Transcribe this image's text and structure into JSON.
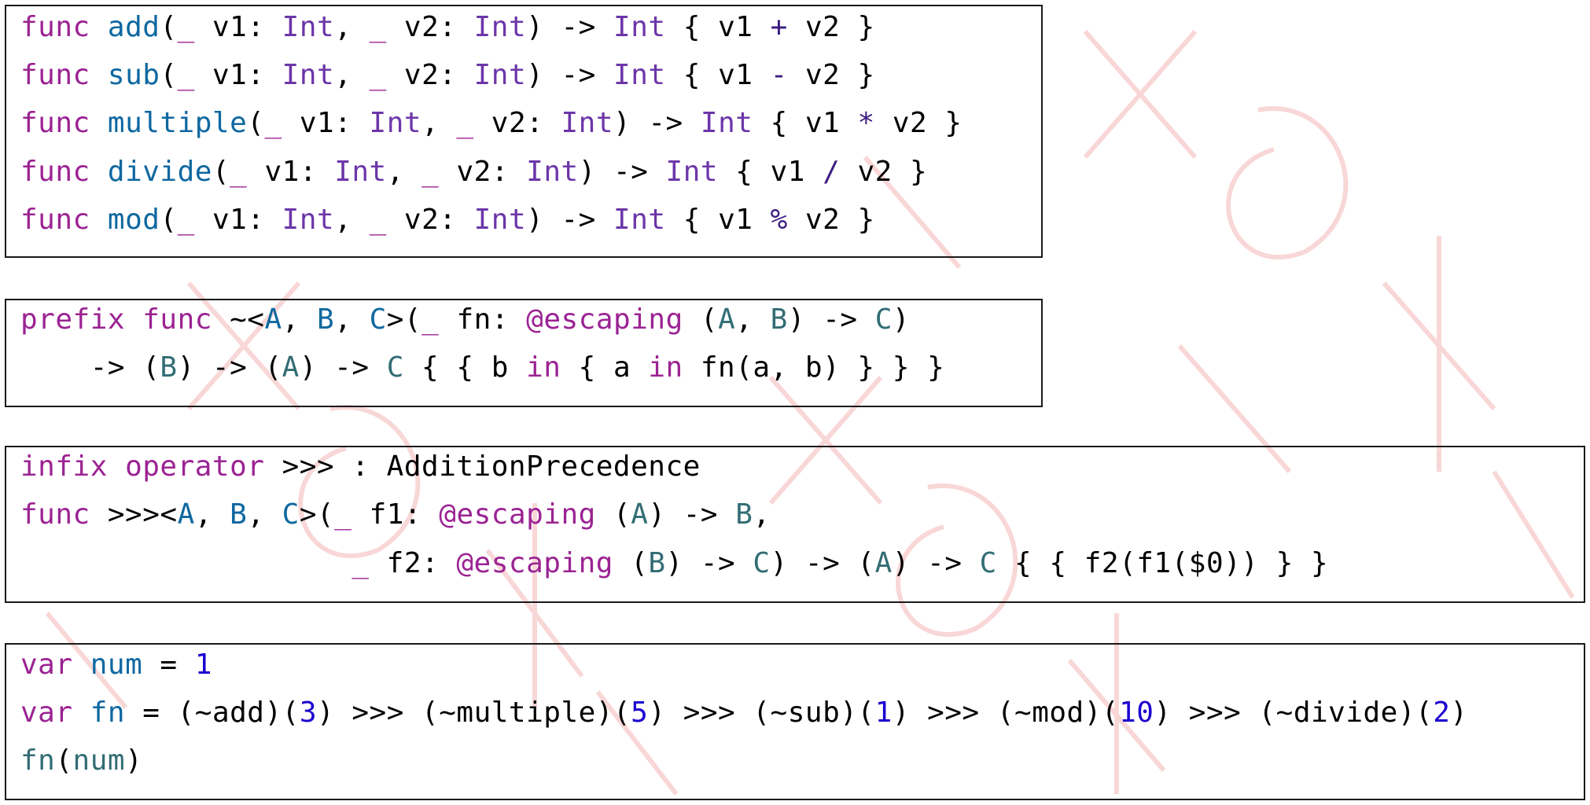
{
  "code_blocks": [
    {
      "lines": [
        [
          [
            "kw",
            "func"
          ],
          [
            "pl",
            " "
          ],
          [
            "fn",
            "add"
          ],
          [
            "pl",
            "("
          ],
          [
            "kw",
            "_"
          ],
          [
            "pl",
            " v1: "
          ],
          [
            "ty",
            "Int"
          ],
          [
            "pl",
            ", "
          ],
          [
            "kw",
            "_"
          ],
          [
            "pl",
            " v2: "
          ],
          [
            "ty",
            "Int"
          ],
          [
            "pl",
            ") -> "
          ],
          [
            "ty",
            "Int"
          ],
          [
            "pl",
            " { v1 "
          ],
          [
            "op",
            "+"
          ],
          [
            "pl",
            " v2 }"
          ]
        ],
        [
          [
            "kw",
            "func"
          ],
          [
            "pl",
            " "
          ],
          [
            "fn",
            "sub"
          ],
          [
            "pl",
            "("
          ],
          [
            "kw",
            "_"
          ],
          [
            "pl",
            " v1: "
          ],
          [
            "ty",
            "Int"
          ],
          [
            "pl",
            ", "
          ],
          [
            "kw",
            "_"
          ],
          [
            "pl",
            " v2: "
          ],
          [
            "ty",
            "Int"
          ],
          [
            "pl",
            ") -> "
          ],
          [
            "ty",
            "Int"
          ],
          [
            "pl",
            " { v1 "
          ],
          [
            "op",
            "-"
          ],
          [
            "pl",
            " v2 }"
          ]
        ],
        [
          [
            "kw",
            "func"
          ],
          [
            "pl",
            " "
          ],
          [
            "fn",
            "multiple"
          ],
          [
            "pl",
            "("
          ],
          [
            "kw",
            "_"
          ],
          [
            "pl",
            " v1: "
          ],
          [
            "ty",
            "Int"
          ],
          [
            "pl",
            ", "
          ],
          [
            "kw",
            "_"
          ],
          [
            "pl",
            " v2: "
          ],
          [
            "ty",
            "Int"
          ],
          [
            "pl",
            ") -> "
          ],
          [
            "ty",
            "Int"
          ],
          [
            "pl",
            " { v1 "
          ],
          [
            "op",
            "*"
          ],
          [
            "pl",
            " v2 }"
          ]
        ],
        [
          [
            "kw",
            "func"
          ],
          [
            "pl",
            " "
          ],
          [
            "fn",
            "divide"
          ],
          [
            "pl",
            "("
          ],
          [
            "kw",
            "_"
          ],
          [
            "pl",
            " v1: "
          ],
          [
            "ty",
            "Int"
          ],
          [
            "pl",
            ", "
          ],
          [
            "kw",
            "_"
          ],
          [
            "pl",
            " v2: "
          ],
          [
            "ty",
            "Int"
          ],
          [
            "pl",
            ") -> "
          ],
          [
            "ty",
            "Int"
          ],
          [
            "pl",
            " { v1 "
          ],
          [
            "op",
            "/"
          ],
          [
            "pl",
            " v2 }"
          ]
        ],
        [
          [
            "kw",
            "func"
          ],
          [
            "pl",
            " "
          ],
          [
            "fn",
            "mod"
          ],
          [
            "pl",
            "("
          ],
          [
            "kw",
            "_"
          ],
          [
            "pl",
            " v1: "
          ],
          [
            "ty",
            "Int"
          ],
          [
            "pl",
            ", "
          ],
          [
            "kw",
            "_"
          ],
          [
            "pl",
            " v2: "
          ],
          [
            "ty",
            "Int"
          ],
          [
            "pl",
            ") -> "
          ],
          [
            "ty",
            "Int"
          ],
          [
            "pl",
            " { v1 "
          ],
          [
            "op",
            "%"
          ],
          [
            "pl",
            " v2 }"
          ]
        ]
      ]
    },
    {
      "lines": [
        [
          [
            "kw",
            "prefix"
          ],
          [
            "pl",
            " "
          ],
          [
            "kw",
            "func"
          ],
          [
            "pl",
            " ~<"
          ],
          [
            "fn",
            "A"
          ],
          [
            "pl",
            ", "
          ],
          [
            "fn",
            "B"
          ],
          [
            "pl",
            ", "
          ],
          [
            "fn",
            "C"
          ],
          [
            "pl",
            ">("
          ],
          [
            "kw",
            "_"
          ],
          [
            "pl",
            " fn: "
          ],
          [
            "at",
            "@escaping"
          ],
          [
            "pl",
            " ("
          ],
          [
            "gn",
            "A"
          ],
          [
            "pl",
            ", "
          ],
          [
            "gn",
            "B"
          ],
          [
            "pl",
            ") -> "
          ],
          [
            "gn",
            "C"
          ],
          [
            "pl",
            ")"
          ]
        ],
        [
          [
            "pl",
            "    -> ("
          ],
          [
            "gn",
            "B"
          ],
          [
            "pl",
            ") -> ("
          ],
          [
            "gn",
            "A"
          ],
          [
            "pl",
            ") -> "
          ],
          [
            "gn",
            "C"
          ],
          [
            "pl",
            " { { b "
          ],
          [
            "kw",
            "in"
          ],
          [
            "pl",
            " { a "
          ],
          [
            "kw",
            "in"
          ],
          [
            "pl",
            " fn(a, b) } } }"
          ]
        ]
      ]
    },
    {
      "lines": [
        [
          [
            "kw",
            "infix"
          ],
          [
            "pl",
            " "
          ],
          [
            "kw",
            "operator"
          ],
          [
            "pl",
            " >>> : AdditionPrecedence"
          ]
        ],
        [
          [
            "kw",
            "func"
          ],
          [
            "pl",
            " >>><"
          ],
          [
            "fn",
            "A"
          ],
          [
            "pl",
            ", "
          ],
          [
            "fn",
            "B"
          ],
          [
            "pl",
            ", "
          ],
          [
            "fn",
            "C"
          ],
          [
            "pl",
            ">("
          ],
          [
            "kw",
            "_"
          ],
          [
            "pl",
            " f1: "
          ],
          [
            "at",
            "@escaping"
          ],
          [
            "pl",
            " ("
          ],
          [
            "gn",
            "A"
          ],
          [
            "pl",
            ") -> "
          ],
          [
            "gn",
            "B"
          ],
          [
            "pl",
            ","
          ]
        ],
        [
          [
            "pl",
            "                   "
          ],
          [
            "kw",
            "_"
          ],
          [
            "pl",
            " f2: "
          ],
          [
            "at",
            "@escaping"
          ],
          [
            "pl",
            " ("
          ],
          [
            "gn",
            "B"
          ],
          [
            "pl",
            ") -> "
          ],
          [
            "gn",
            "C"
          ],
          [
            "pl",
            ") -> ("
          ],
          [
            "gn",
            "A"
          ],
          [
            "pl",
            ") -> "
          ],
          [
            "gn",
            "C"
          ],
          [
            "pl",
            " { { f2(f1($0)) } }"
          ]
        ]
      ]
    },
    {
      "lines": [
        [
          [
            "kw",
            "var"
          ],
          [
            "pl",
            " "
          ],
          [
            "fn",
            "num"
          ],
          [
            "pl",
            " = "
          ],
          [
            "nm",
            "1"
          ]
        ],
        [
          [
            "kw",
            "var"
          ],
          [
            "pl",
            " "
          ],
          [
            "fn",
            "fn"
          ],
          [
            "pl",
            " = (~add)("
          ],
          [
            "nm",
            "3"
          ],
          [
            "pl",
            ") >>> (~multiple)("
          ],
          [
            "nm",
            "5"
          ],
          [
            "pl",
            ") >>> (~sub)("
          ],
          [
            "nm",
            "1"
          ],
          [
            "pl",
            ") >>> (~mod)("
          ],
          [
            "nm",
            "10"
          ],
          [
            "pl",
            ") >>> (~divide)("
          ],
          [
            "nm",
            "2"
          ],
          [
            "pl",
            ")"
          ]
        ],
        [
          [
            "gn",
            "fn"
          ],
          [
            "pl",
            "("
          ],
          [
            "gn",
            "num"
          ],
          [
            "pl",
            ")"
          ]
        ]
      ]
    }
  ],
  "colors": {
    "keyword": "#9b2393",
    "function": "#0f68a0",
    "type": "#6c36a9",
    "operator": "#3d1d81",
    "generic": "#326d74",
    "number": "#1c00cf",
    "plain": "#000000",
    "watermark": "#f6c9c9"
  }
}
